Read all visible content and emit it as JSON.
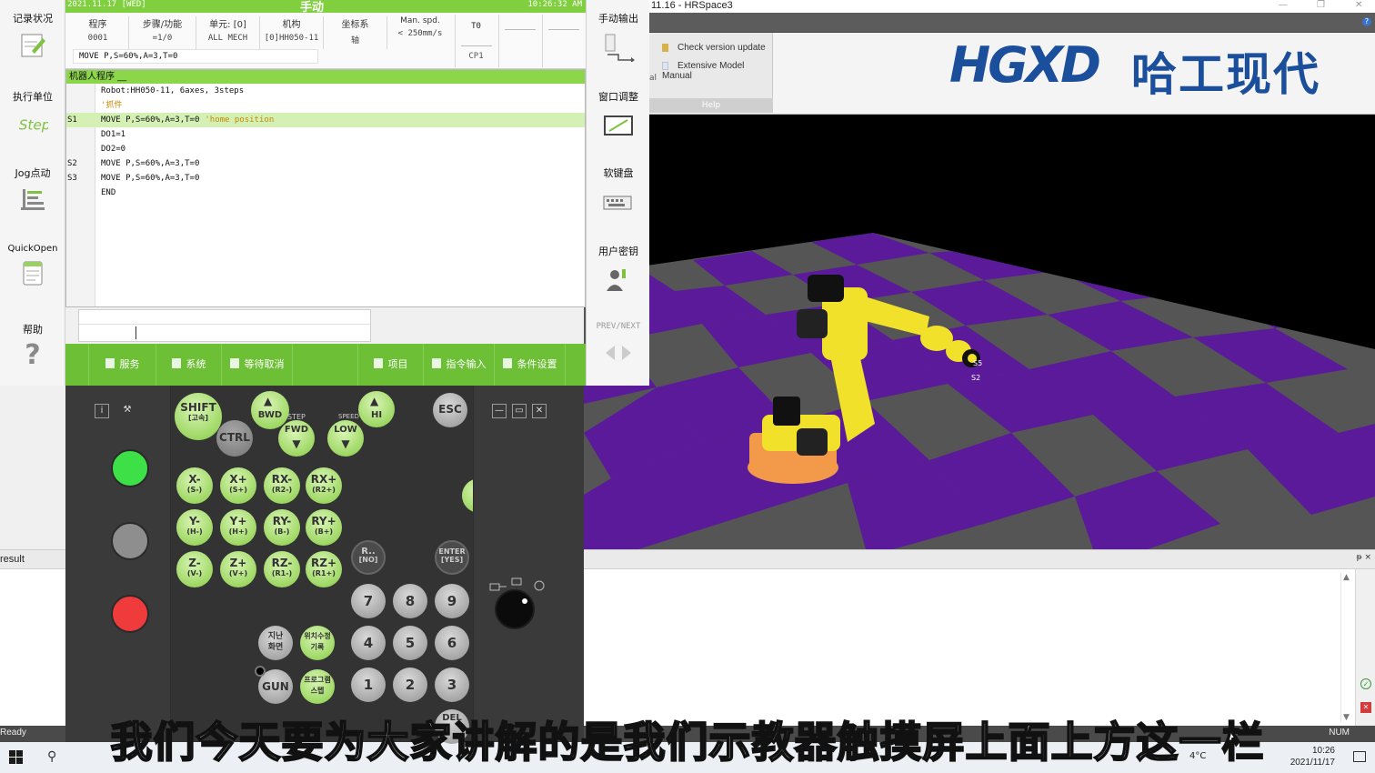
{
  "hrspace": {
    "title": "11.16 - HRSpace3",
    "help_items": [
      "Check version update",
      "Extensive Model Manual"
    ],
    "help_group_label": "Help",
    "left_fragment": "al",
    "logo_latin": "HGXD",
    "logo_cn": "哈工现代",
    "axis_label_5": "S5",
    "axis_label_2": "S2",
    "result_label": "result",
    "status_ready": "Ready",
    "status_num": "NUM",
    "taskbar_temp": "4°C",
    "taskbar_time": "10:26",
    "taskbar_date": "2021/11/17",
    "colors": {
      "floor_purple": "#5a1a9a",
      "floor_grey": "#555555",
      "robot_yellow": "#f2e12a",
      "base_orange": "#f39a4a",
      "logo_blue": "#1b4f9c"
    }
  },
  "pendant": {
    "top": {
      "date": "2021.11.17 [WED]",
      "mode": "手动",
      "clock": "10:26:32 AM"
    },
    "info": [
      {
        "key": "程序",
        "value": "0001"
      },
      {
        "key": "步骤/功能",
        "value": "=1/0"
      },
      {
        "key": "单元: [0]",
        "value": "ALL MECH"
      },
      {
        "key": "机构",
        "value": "[0]HH050-11"
      },
      {
        "key": "坐标系",
        "value": "轴"
      },
      {
        "key": "Man. spd.",
        "value": "< 250mm/s"
      }
    ],
    "info_boxes": [
      {
        "top": "T0",
        "bottom": "CP1"
      },
      {
        "top": "",
        "bottom": ""
      },
      {
        "top": "",
        "bottom": ""
      }
    ],
    "current_line": "MOVE P,S=60%,A=3,T=0",
    "program": {
      "header": "机器人程序 __",
      "rows": [
        {
          "label": "",
          "code": "Robot:HH050-11, 6axes, 3steps",
          "comment": ""
        },
        {
          "label": "",
          "code": "",
          "comment": "'抓件"
        },
        {
          "label": "S1",
          "code": "MOVE P,S=60%,A=3,T=0",
          "comment": "'home position"
        },
        {
          "label": "",
          "code": "DO1=1",
          "comment": ""
        },
        {
          "label": "",
          "code": "DO2=0",
          "comment": ""
        },
        {
          "label": "S2",
          "code": "MOVE P,S=60%,A=3,T=0",
          "comment": ""
        },
        {
          "label": "S3",
          "code": "MOVE P,S=60%,A=3,T=0",
          "comment": ""
        },
        {
          "label": "",
          "code": "END",
          "comment": ""
        }
      ]
    },
    "left_strip": [
      "记录状况",
      "执行单位",
      "Jog点动",
      "QuickOpen",
      "帮助"
    ],
    "step_text": "Step",
    "help_glyph": "?",
    "right_strip": [
      "手动输出",
      "窗口调整",
      "软键盘",
      "用户密钥",
      "PREV/NEXT"
    ],
    "menu": [
      "服务",
      "系统",
      "等待取消",
      "项目",
      "指令输入",
      "条件设置"
    ],
    "keys": {
      "shift": "SHIFT",
      "shift_sub": "[고속]",
      "ctrl": "CTRL",
      "bwd": "BWD",
      "step": "STEP",
      "fwd": "FWD",
      "speed": "SPEED",
      "hi": "HI",
      "low": "LOW",
      "esc": "ESC",
      "jog": [
        [
          "X-",
          "(S-)"
        ],
        [
          "X+",
          "(S+)"
        ],
        [
          "RX-",
          "(R2-)"
        ],
        [
          "RX+",
          "(R2+)"
        ],
        [
          "Y-",
          "(H-)"
        ],
        [
          "Y+",
          "(H+)"
        ],
        [
          "RY-",
          "(B-)"
        ],
        [
          "RY+",
          "(B+)"
        ],
        [
          "Z-",
          "(V-)"
        ],
        [
          "Z+",
          "(V+)"
        ],
        [
          "RZ-",
          "(R1-)"
        ],
        [
          "RZ+",
          "(R1+)"
        ]
      ],
      "r_no": "R..",
      "r_no_sub": "[NO]",
      "enter": "ENTER",
      "enter_sub": "[YES]",
      "nums": [
        "7",
        "8",
        "9",
        "4",
        "5",
        "6",
        "1",
        "2",
        "3"
      ],
      "prev_screen": "지난\n화면",
      "pos_edit": "위치수정\n기록",
      "gun": "GUN",
      "prog_step": "프로그램\n스텝",
      "del": "DEL",
      "info_icon": "i",
      "tool_icon": "⚒"
    }
  },
  "subtitle": "我们今天要为大家讲解的是我们示教器触摸屏上面上方这一栏"
}
